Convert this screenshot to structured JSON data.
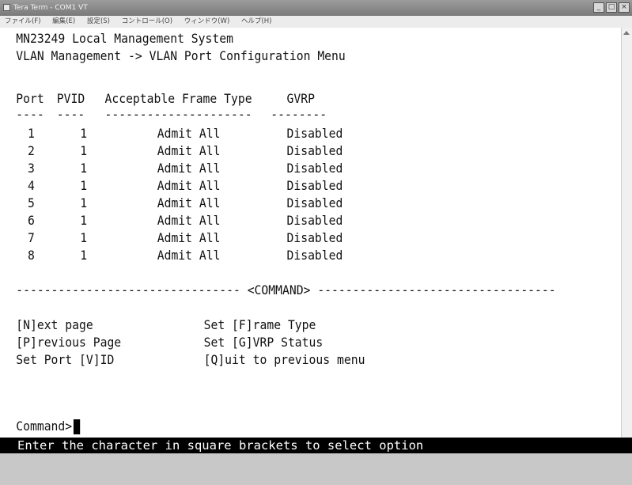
{
  "window": {
    "title": "Tera Term - COM1 VT",
    "menu": [
      "ファイル(F)",
      "編集(E)",
      "設定(S)",
      "コントロール(O)",
      "ウィンドウ(W)",
      "ヘルプ(H)"
    ]
  },
  "terminal": {
    "header1": "MN23249 Local Management System",
    "header2": "VLAN Management -> VLAN Port Configuration Menu",
    "columns": [
      "Port",
      "PVID",
      "Acceptable Frame Type",
      "GVRP"
    ],
    "column_underlines": [
      "----",
      "----",
      "---------------------",
      "--------"
    ],
    "rows": [
      {
        "port": "1",
        "pvid": "1",
        "frame_type": "Admit All",
        "gvrp": "Disabled"
      },
      {
        "port": "2",
        "pvid": "1",
        "frame_type": "Admit All",
        "gvrp": "Disabled"
      },
      {
        "port": "3",
        "pvid": "1",
        "frame_type": "Admit All",
        "gvrp": "Disabled"
      },
      {
        "port": "4",
        "pvid": "1",
        "frame_type": "Admit All",
        "gvrp": "Disabled"
      },
      {
        "port": "5",
        "pvid": "1",
        "frame_type": "Admit All",
        "gvrp": "Disabled"
      },
      {
        "port": "6",
        "pvid": "1",
        "frame_type": "Admit All",
        "gvrp": "Disabled"
      },
      {
        "port": "7",
        "pvid": "1",
        "frame_type": "Admit All",
        "gvrp": "Disabled"
      },
      {
        "port": "8",
        "pvid": "1",
        "frame_type": "Admit All",
        "gvrp": "Disabled"
      }
    ],
    "command_separator": "-------------------------------- <COMMAND> ----------------------------------",
    "commands_left": [
      "[N]ext page",
      "[P]revious Page",
      "Set Port [V]ID"
    ],
    "commands_right": [
      "Set [F]rame Type",
      "Set [G]VRP Status",
      "[Q]uit to previous menu"
    ],
    "prompt": "Command>",
    "status": "Enter the character in square brackets to select option"
  }
}
